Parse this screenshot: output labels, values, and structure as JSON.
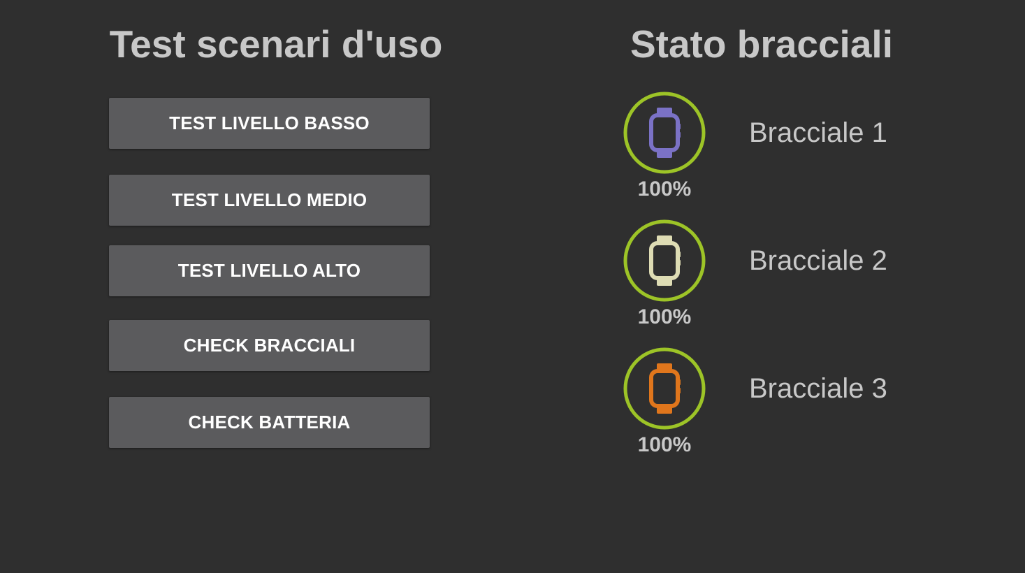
{
  "left_panel": {
    "title": "Test scenari d'uso",
    "buttons": [
      {
        "label": "TEST LIVELLO BASSO"
      },
      {
        "label": "TEST LIVELLO MEDIO"
      },
      {
        "label": "TEST LIVELLO ALTO"
      },
      {
        "label": "CHECK BRACCIALI"
      },
      {
        "label": "CHECK BATTERIA"
      }
    ]
  },
  "right_panel": {
    "title": "Stato bracciali",
    "bracelets": [
      {
        "name": "Bracciale 1",
        "battery": "100%",
        "battery_fraction": 1.0,
        "icon": "smartwatch-icon",
        "color": "#7b72c6"
      },
      {
        "name": "Bracciale 2",
        "battery": "100%",
        "battery_fraction": 1.0,
        "icon": "smartwatch-icon",
        "color": "#dedcb4"
      },
      {
        "name": "Bracciale 3",
        "battery": "100%",
        "battery_fraction": 1.0,
        "icon": "smartwatch-icon",
        "color": "#e0761c"
      }
    ],
    "ring_color": "#9dc427"
  },
  "colors": {
    "background": "#2f2f2f",
    "button": "#5b5b5d",
    "text": "#c8c8c8"
  }
}
